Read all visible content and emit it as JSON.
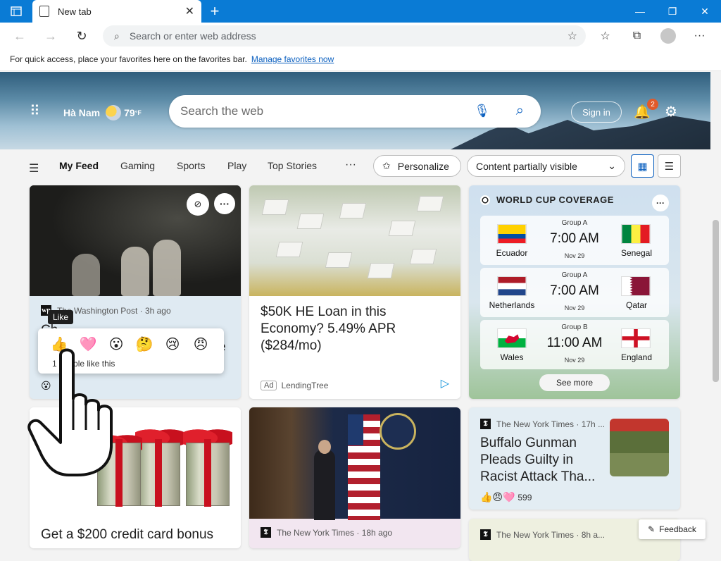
{
  "browser": {
    "tab_title": "New tab",
    "address_placeholder": "Search or enter web address",
    "favbar_text": "For quick access, place your favorites here on the favorites bar.",
    "favbar_link": "Manage favorites now"
  },
  "header": {
    "location": "Hà Nam",
    "temperature": "79",
    "temp_unit": "°F",
    "search_placeholder": "Search the web",
    "signin_label": "Sign in",
    "notification_count": "2"
  },
  "feed_nav": {
    "tabs": [
      "My Feed",
      "Gaming",
      "Sports",
      "Play",
      "Top Stories"
    ],
    "more": "···",
    "personalize": "Personalize",
    "visibility": "Content partially visible"
  },
  "cards": {
    "c1": {
      "source": "The Washington Post · 3h ago",
      "source_logo": "wp",
      "headline_partial": "Ch",
      "headline_partial2": "e",
      "reaction_count": "people like this",
      "reaction_count_prefix": "1"
    },
    "c2": {
      "headline": "$50K HE Loan in this Economy? 5.49% APR ($284/mo)",
      "ad_tag": "Ad",
      "advertiser": "LendingTree"
    },
    "c3": {
      "title": "WORLD CUP COVERAGE",
      "matches": [
        {
          "group": "Group A",
          "time": "7:00 AM",
          "date": "Nov 29",
          "home": "Ecuador",
          "away": "Senegal"
        },
        {
          "group": "Group A",
          "time": "7:00 AM",
          "date": "Nov 29",
          "home": "Netherlands",
          "away": "Qatar"
        },
        {
          "group": "Group B",
          "time": "11:00 AM",
          "date": "Nov 29",
          "home": "Wales",
          "away": "England"
        }
      ],
      "see_more": "See more"
    },
    "c4": {
      "headline": "Get a $200 credit card bonus"
    },
    "c5": {
      "source": "The New York Times · 18h ago"
    },
    "c6": {
      "source": "The New York Times · 17h ...",
      "headline": "Buffalo Gunman Pleads Guilty in Racist Attack Tha...",
      "reactions": "599"
    },
    "c7": {
      "source": "The New York Times · 8h a..."
    }
  },
  "reaction_popup": {
    "tooltip": "Like"
  },
  "feedback_label": "Feedback",
  "colors": {
    "accent": "#0a7bd5",
    "link": "#0a5fbf"
  }
}
